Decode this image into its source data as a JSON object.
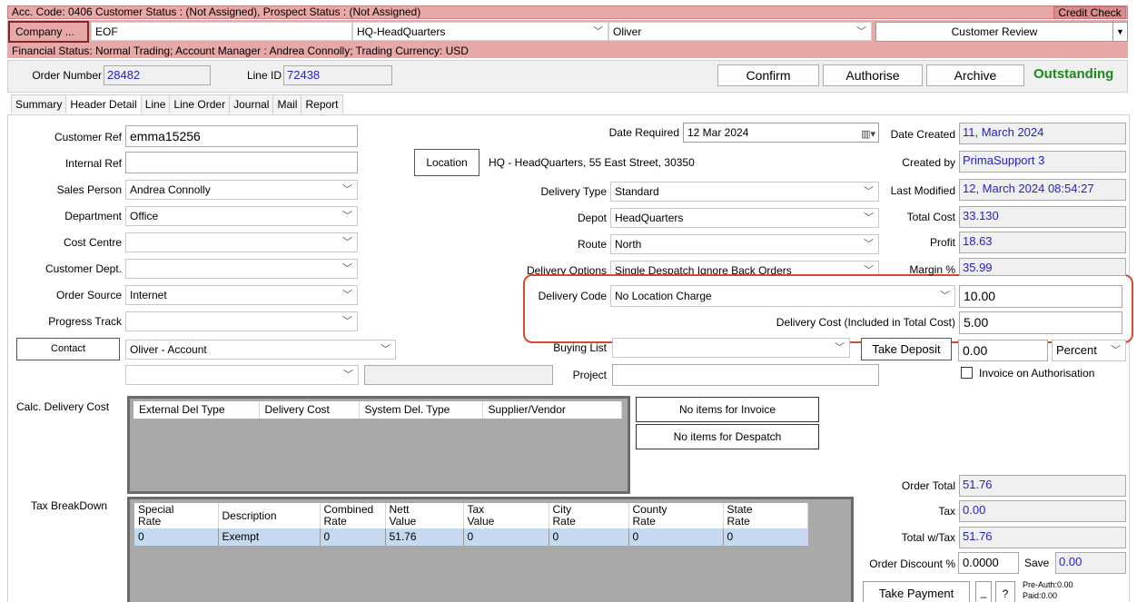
{
  "top_bar": {
    "acc_status": "Acc. Code: 0406  Customer Status : (Not Assigned), Prospect Status : (Not Assigned)",
    "credit_check": "Credit Check",
    "company_button": "Company ...",
    "company_value": "EOF",
    "branch_value": "HQ-HeadQuarters",
    "contact_value": "Oliver",
    "review_value": "Customer Review",
    "financial_status": "Financial Status: Normal Trading;  Account Manager : Andrea Connolly; Trading Currency: USD"
  },
  "order_bar": {
    "order_number_label": "Order Number",
    "order_number": "28482",
    "line_id_label": "Line ID",
    "line_id": "72438",
    "confirm": "Confirm",
    "authorise": "Authorise",
    "archive": "Archive",
    "status": "Outstanding"
  },
  "tabs": [
    "Summary",
    "Header Detail",
    "Line",
    "Line Order",
    "Journal",
    "Mail",
    "Report"
  ],
  "left_fields": {
    "customer_ref_label": "Customer Ref",
    "customer_ref": "emma15256",
    "internal_ref_label": "Internal Ref",
    "internal_ref": "",
    "sales_person_label": "Sales Person",
    "sales_person": "Andrea Connolly",
    "department_label": "Department",
    "department": "Office",
    "cost_centre_label": "Cost Centre",
    "cost_centre": "",
    "customer_dept_label": "Customer Dept.",
    "customer_dept": "",
    "order_source_label": "Order Source",
    "order_source": "Internet",
    "progress_track_label": "Progress Track",
    "progress_track": "",
    "contact_button": "Contact",
    "contact_value": "Oliver - Account"
  },
  "middle_fields": {
    "date_required_label": "Date Required",
    "date_required": "12 Mar 2024",
    "location_button": "Location",
    "location_value": "HQ - HeadQuarters, 55 East Street, 30350",
    "delivery_type_label": "Delivery Type",
    "delivery_type": "Standard",
    "depot_label": "Depot",
    "depot": "HeadQuarters",
    "route_label": "Route",
    "route": "North",
    "delivery_options_label": "Delivery Options",
    "delivery_options": "Single Despatch Ignore Back Orders",
    "delivery_code_label": "Delivery Code",
    "delivery_code": "No Location Charge",
    "delivery_code_amount": "10.00",
    "delivery_cost_label": "Delivery Cost (Included in Total Cost)",
    "delivery_cost": "5.00",
    "buying_list_label": "Buying List",
    "buying_list": "",
    "project_label": "Project",
    "project": ""
  },
  "right_fields": {
    "date_created_label": "Date Created",
    "date_created": "11, March 2024",
    "created_by_label": "Created by",
    "created_by": "PrimaSupport 3",
    "last_modified_label": "Last Modified",
    "last_modified": "12, March 2024  08:54:27",
    "total_cost_label": "Total Cost",
    "total_cost": "33.130",
    "profit_label": "Profit",
    "profit": "18.63",
    "margin_label": "Margin %",
    "margin": "35.99",
    "take_deposit": "Take Deposit",
    "deposit_value": "0.00",
    "deposit_mode": "Percent",
    "invoice_on_auth": "Invoice on Authorisation"
  },
  "delivery_grid": {
    "label": "Calc. Delivery Cost",
    "columns": [
      "External Del Type",
      "Delivery Cost",
      "System Del. Type",
      "Supplier/Vendor"
    ]
  },
  "invoice_status": {
    "no_items_invoice": "No items for Invoice",
    "no_items_despatch": "No items for Despatch"
  },
  "tax_grid": {
    "label": "Tax BreakDown",
    "columns": [
      "Special\nRate",
      "Description",
      "Combined\nRate",
      "Nett\nValue",
      "Tax\nValue",
      "City\nRate",
      "County\nRate",
      "State\nRate"
    ],
    "rows": [
      [
        "0",
        "Exempt",
        "0",
        "51.76",
        "0",
        "0",
        "0",
        "0"
      ]
    ]
  },
  "totals": {
    "order_total_label": "Order Total",
    "order_total": "51.76",
    "tax_label": "Tax",
    "tax": "0.00",
    "total_w_tax_label": "Total w/Tax",
    "total_w_tax": "51.76",
    "order_discount_label": "Order Discount %",
    "order_discount": "0.0000",
    "save_label": "Save",
    "save_value": "0.00",
    "take_payment": "Take Payment",
    "dash_button": "_",
    "help_button": "?",
    "pre_auth": "Pre-Auth:0.00",
    "paid": "Paid:0.00"
  },
  "colors": {
    "pink_bar": "#e8a8a8",
    "highlight_border": "#d9482b",
    "status_green": "#1a8a1a",
    "link_blue": "#1f1fc8"
  }
}
